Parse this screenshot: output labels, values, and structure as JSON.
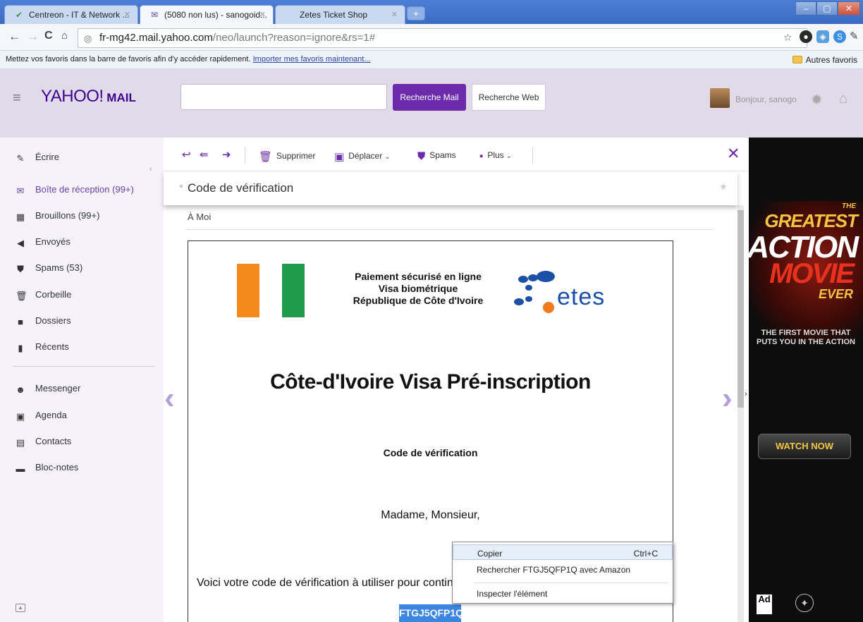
{
  "browser": {
    "tabs": [
      {
        "title": "Centreon - IT & Network ...",
        "icon": "centreon-icon",
        "active": false
      },
      {
        "title": "(5080 non lus) - sanogoid...",
        "icon": "mail-icon",
        "active": true
      },
      {
        "title": "Zetes Ticket Shop",
        "icon": "",
        "active": false
      }
    ],
    "new_tab": "+",
    "url_host": "fr-mg42.mail.yahoo.com",
    "url_path": "/neo/launch?reason=ignore&rs=1#",
    "bookmarks_hint": "Mettez vos favoris dans la barre de favoris afin d'y accéder rapidement.",
    "bookmarks_link": "Importer mes favoris maintenant...",
    "other_bookmarks": "Autres favoris"
  },
  "header": {
    "logo_main": "YAHOO!",
    "logo_suffix": " MAIL",
    "search_placeholder": "",
    "search_mail_label": "Recherche Mail",
    "search_web_label": "Recherche Web",
    "greeting": "Bonjour, sanogo"
  },
  "sidebar": {
    "compose": "Écrire",
    "items": [
      {
        "label": "Boîte de réception (99+)",
        "icon": "inbox-icon"
      },
      {
        "label": "Brouillons (99+)",
        "icon": "drafts-icon"
      },
      {
        "label": "Envoyés",
        "icon": "sent-icon"
      },
      {
        "label": "Spams (53)",
        "icon": "spam-icon"
      },
      {
        "label": "Corbeille",
        "icon": "trash-icon"
      },
      {
        "label": "Dossiers",
        "icon": "folder-icon"
      },
      {
        "label": "Récents",
        "icon": "recent-icon"
      }
    ],
    "apps": [
      {
        "label": "Messenger",
        "icon": "messenger-icon"
      },
      {
        "label": "Agenda",
        "icon": "calendar-icon"
      },
      {
        "label": "Contacts",
        "icon": "contacts-icon"
      },
      {
        "label": "Bloc-notes",
        "icon": "notepad-icon"
      }
    ]
  },
  "message_toolbar": {
    "delete": "Supprimer",
    "move": "Déplacer",
    "spam": "Spams",
    "more": "Plus"
  },
  "message": {
    "subject": "Code de vérification",
    "to": "À Moi"
  },
  "email_body": {
    "header_lines": [
      "Paiement sécurisé en ligne",
      "Visa biométrique",
      "République de Côte d'Ivoire"
    ],
    "logo_text": "etes",
    "title": "Côte-d'Ivoire Visa Pré-inscription",
    "code_heading": "Code de vérification",
    "salutation": "Madame, Monsieur,",
    "intro": "Voici votre code de vérification à utiliser pour continuer",
    "code": "FTGJ5QFP1Q"
  },
  "context_menu": {
    "copy": "Copier",
    "copy_shortcut": "Ctrl+C",
    "search": "Rechercher FTGJ5QFP1Q avec Amazon",
    "inspect": "Inspecter l'élément"
  },
  "ad": {
    "the": "THE",
    "greatest": "GREATEST",
    "action": "ACTION",
    "movie": "MOVIE",
    "ever": "EVER",
    "tagline": "THE FIRST MOVIE THAT PUTS YOU IN THE ACTION",
    "cta": "WATCH NOW",
    "council": "Ad"
  },
  "colors": {
    "yahoo_purple": "#400090",
    "button_purple": "#6b2bab",
    "header_bg": "#e0dae9",
    "code_highlight": "#3a86e0"
  }
}
